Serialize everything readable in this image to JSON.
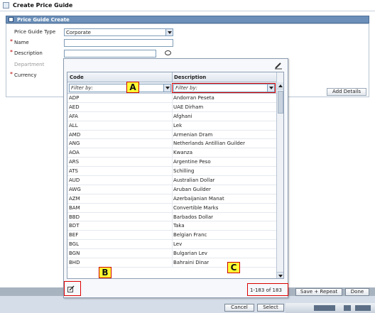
{
  "window": {
    "title": "Create Price Guide"
  },
  "section": {
    "title": "Price Guide Create"
  },
  "form": {
    "price_guide_type_label": "Price Guide Type",
    "price_guide_type_value": "Corporate",
    "name_label": "Name",
    "description_label": "Description",
    "department_label": "Department",
    "currency_label": "Currency",
    "required_marker": "*"
  },
  "buttons": {
    "add_details": "Add Details",
    "save_repeat": "Save + Repeat",
    "done": "Done",
    "cancel": "Cancel",
    "select": "Select"
  },
  "popup": {
    "columns": [
      "Code",
      "Description"
    ],
    "filter_placeholder": "Filter by:",
    "rows": [
      [
        "ADP",
        "Andorran Peseta"
      ],
      [
        "AED",
        "UAE Dirham"
      ],
      [
        "AFA",
        "Afghani"
      ],
      [
        "ALL",
        "Lek"
      ],
      [
        "AMD",
        "Armenian Dram"
      ],
      [
        "ANG",
        "Netherlands Antillian Guilder"
      ],
      [
        "AOA",
        "Kwanza"
      ],
      [
        "ARS",
        "Argentine Peso"
      ],
      [
        "ATS",
        "Schilling"
      ],
      [
        "AUD",
        "Australian Dollar"
      ],
      [
        "AWG",
        "Aruban Guilder"
      ],
      [
        "AZM",
        "Azerbaijanian Manat"
      ],
      [
        "BAM",
        "Convertible Marks"
      ],
      [
        "BBD",
        "Barbados Dollar"
      ],
      [
        "BDT",
        "Taka"
      ],
      [
        "BEF",
        "Belgian Franc"
      ],
      [
        "BGL",
        "Lev"
      ],
      [
        "BGN",
        "Bulgarian Lev"
      ],
      [
        "BHD",
        "Bahraini Dinar"
      ]
    ],
    "page_count": "1-183 of 183"
  },
  "callouts": {
    "a": "A",
    "b": "B",
    "c": "C"
  },
  "colors": {
    "section_header": "#6b8fb8",
    "callout_fill": "#ffff33",
    "callout_border": "#cc0000"
  }
}
